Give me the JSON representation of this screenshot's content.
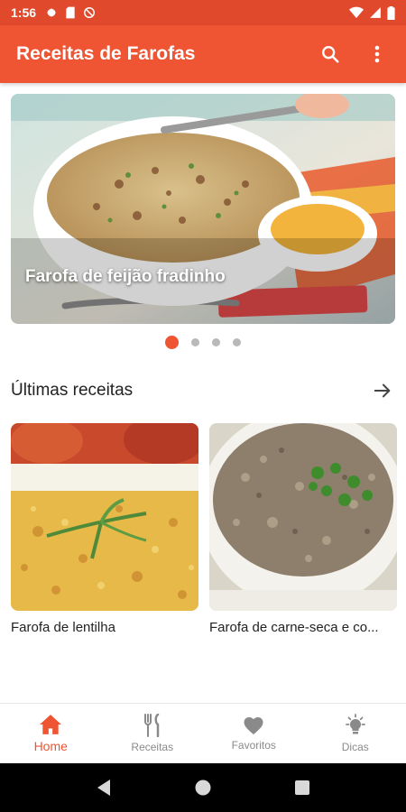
{
  "status_bar": {
    "time": "1:56",
    "icons_left": [
      "gear-icon",
      "sd-card-icon",
      "no-sync-icon"
    ],
    "icons_right": [
      "wifi-icon",
      "signal-icon",
      "battery-icon"
    ]
  },
  "app_bar": {
    "title": "Receitas de Farofas",
    "actions": [
      "search-icon",
      "more-vert-icon"
    ]
  },
  "carousel": {
    "title": "Farofa de feijão fradinho",
    "page_count": 4,
    "active_index": 0
  },
  "latest": {
    "title": "Últimas receitas",
    "items": [
      {
        "label": "Farofa de lentilha"
      },
      {
        "label": "Farofa de carne-seca e co..."
      }
    ]
  },
  "bottom_nav": {
    "items": [
      {
        "label": "Home",
        "icon": "home-icon",
        "active": true
      },
      {
        "label": "Receitas",
        "icon": "fork-knife-icon",
        "active": false
      },
      {
        "label": "Favoritos",
        "icon": "heart-icon",
        "active": false
      },
      {
        "label": "Dicas",
        "icon": "lightbulb-icon",
        "active": false
      }
    ]
  },
  "colors": {
    "primary": "#ef5533",
    "status_bar": "#e0492b",
    "inactive": "#8a8a8a"
  }
}
